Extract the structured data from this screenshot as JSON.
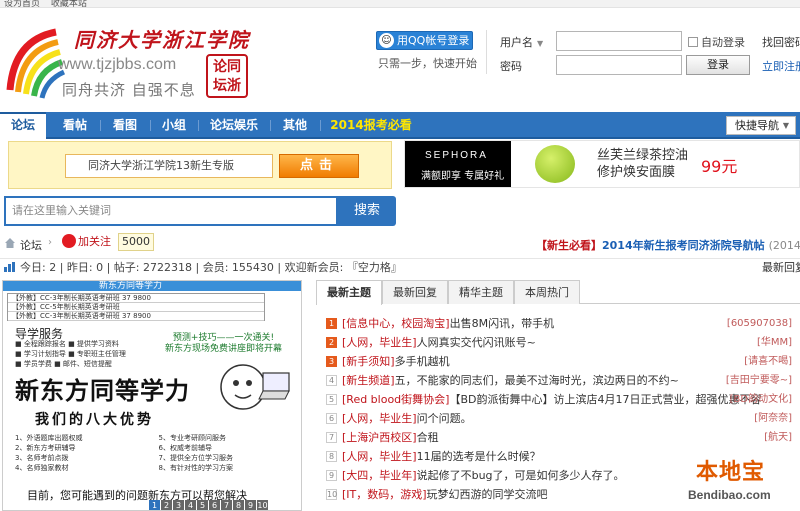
{
  "topbar": {
    "sethome": "设为首页",
    "favorite": "收藏本站"
  },
  "header": {
    "site_title": "同济大学浙江学院",
    "url": "www.tjzjbbs.com",
    "slogan": "同舟共济 自强不息",
    "seal_text": "论同坛浙"
  },
  "login": {
    "qq_button": "用QQ帐号登录",
    "one_step": "只需一步，快速开始",
    "username_label": "用户名",
    "password_label": "密码",
    "auto_login": "自动登录",
    "login_button": "登录",
    "find_password": "找回密码",
    "register": "立即注册"
  },
  "nav": {
    "items": [
      "论坛",
      "看帖",
      "看图",
      "小组",
      "论坛娱乐",
      "其他",
      "2014报考必看"
    ],
    "quick_nav": "快捷导航"
  },
  "banner_left": {
    "text": "同济大学浙江学院13新生专版",
    "button": "点击"
  },
  "banner_right": {
    "brand": "SEPHORA",
    "brand_sub": "满额即享 专属好礼",
    "product": "丝芙兰绿茶控油修护焕安面膜",
    "price": "99元"
  },
  "search": {
    "placeholder": "请在这里输入关键词",
    "button": "搜索"
  },
  "breadcrumb": {
    "home": "论坛",
    "weibo_follow": "加关注",
    "follow_count": "5000",
    "notice_tag": "【新生必看】",
    "notice_title": "2014年新生报考同济浙院导航帖",
    "notice_date": "(2014-6-10)"
  },
  "stats": {
    "today": "今日: 2",
    "yesterday": "昨日: 0",
    "posts": "帖子: 2722318",
    "members": "会员: 155430",
    "welcome": "欢迎新会员: 『空力格』",
    "latest": "最新回复"
  },
  "slide": {
    "header": "新东方同等学力",
    "table_rows": [
      "【外教】CC-3年制长期英语考研班   37   9800",
      "【外教】CC-5年制长期英语考研班",
      "【外教】CC-3年制长期英语考研班   37   8900"
    ],
    "section_title": "导学服务",
    "services": [
      "■ 全程跟踪报名   ■ 提供学习资料",
      "■ 学习计划指导   ■ 专职班主任管理",
      "■ 学员学费   ■ 邮件、短信提醒"
    ],
    "promo": [
      "预测+技巧——一次通关!",
      "新东方现场免费讲座即将开幕"
    ],
    "big_title": "新东方同等学力",
    "advantage_title": "我们的八大优势",
    "advantages": [
      "1、外语题库出题权威",
      "2、新东方考研辅导",
      "3、名师考前点拨",
      "4、名师独家教材",
      "5、专业考研顾问服务",
      "6、权威考前辅导",
      "7、提供全方位学习服务",
      "8、有针对性的学习方案"
    ],
    "bottom": "目前，您可能遇到的问题新东方可以帮您解决",
    "pages": [
      "1",
      "2",
      "3",
      "4",
      "5",
      "6",
      "7",
      "8",
      "9",
      "10"
    ]
  },
  "tabs": [
    "最新主题",
    "最新回复",
    "精华主题",
    "本周热门"
  ],
  "threads": [
    {
      "num": "1",
      "cat": "[信息中心，校园淘宝]",
      "title": "出售8M闪讯，带手机",
      "author": "[605907038]"
    },
    {
      "num": "2",
      "cat": "[人网，毕业生]",
      "title": "人网真实交代闪讯账号~",
      "author": "[华MM]"
    },
    {
      "num": "3",
      "cat": "[新手须知]",
      "title": "多手机越机",
      "author": "[请喜不喝]"
    },
    {
      "num": "4",
      "cat": "[新生频道]",
      "title": "五，不能家的同志们，最美不过海时光，滨边两日的不约~",
      "author": "[吉田宁要零~]"
    },
    {
      "num": "5",
      "cat": "[Red blood街舞协会]",
      "title": "【BD韵派街舞中心】访上滨店4月17日正式营业，超强优惠不容",
      "author": "[BD韵动文化]"
    },
    {
      "num": "6",
      "cat": "[人网，毕业生]",
      "title": "问个问题。",
      "author": "[阿奈奈]"
    },
    {
      "num": "7",
      "cat": "[上海沪西校区]",
      "title": "合租",
      "author": "[航天]"
    },
    {
      "num": "8",
      "cat": "[人网，毕业生]",
      "title": "11届的选考是什么时候？",
      "author": ""
    },
    {
      "num": "9",
      "cat": "[大四，毕业年]",
      "title": "说起修了不bug了，可是如何多少人存了。",
      "author": ""
    },
    {
      "num": "10",
      "cat": "[IT，数码，游戏]",
      "title": "玩梦幻西游的同学交流吧",
      "author": ""
    }
  ],
  "watermark": {
    "cn": "本地宝",
    "en": "Bendibao.com"
  },
  "colors": {
    "primary": "#2e73bd",
    "accent_red": "#c0141b",
    "highlight": "#ffe600"
  }
}
